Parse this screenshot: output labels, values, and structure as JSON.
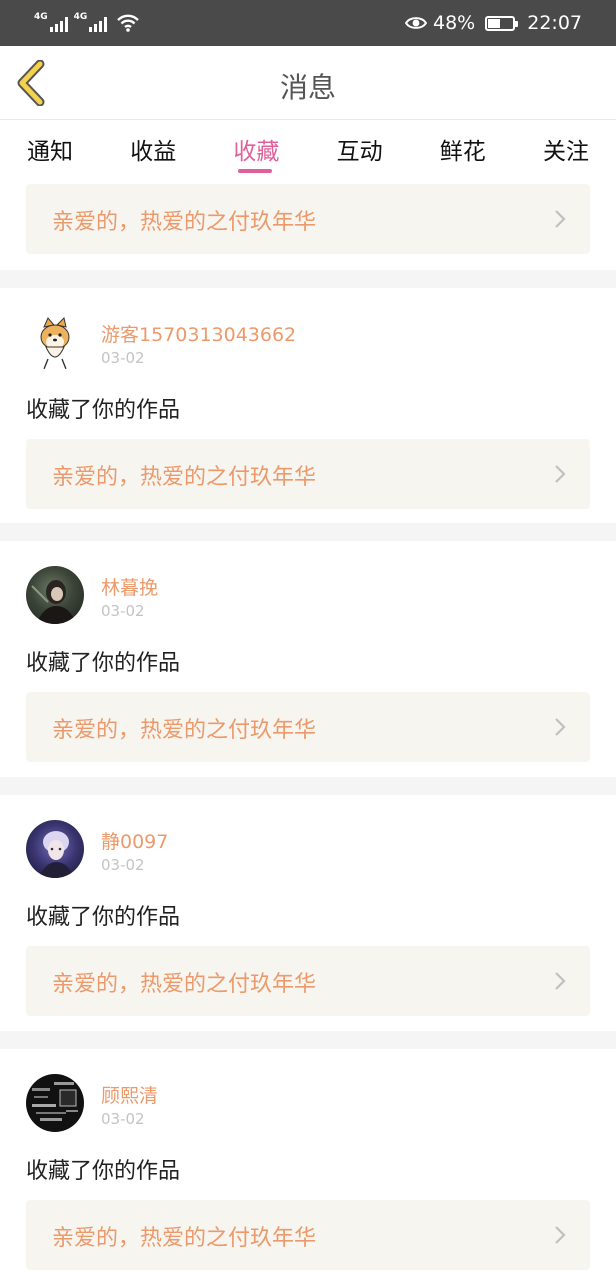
{
  "status_bar": {
    "network_1": "4G",
    "network_2": "4G",
    "battery_text": "48%",
    "battery_level": 0.48,
    "time": "22:07",
    "icons": [
      "signal-icon",
      "signal-icon",
      "wifi-icon",
      "eye-icon",
      "battery-icon"
    ]
  },
  "header": {
    "title": "消息",
    "back_icon": "chevron-left-icon",
    "accent_color": "#f5d24b"
  },
  "tabs": [
    {
      "label": "通知",
      "active": false
    },
    {
      "label": "收益",
      "active": false
    },
    {
      "label": "收藏",
      "active": true
    },
    {
      "label": "互动",
      "active": false
    },
    {
      "label": "鲜花",
      "active": false
    },
    {
      "label": "关注",
      "active": false
    }
  ],
  "colors": {
    "active_tab": "#e0609a",
    "username": "#ec9a6b",
    "card_bg": "#f6f5f0"
  },
  "top_card": {
    "work_title": "亲爱的，热爱的之付玖年华"
  },
  "items": [
    {
      "username": "游客1570313043662",
      "date": "03-02",
      "action": "收藏了你的作品",
      "work_title": "亲爱的，热爱的之付玖年华",
      "avatar": "shiba-dog-avatar"
    },
    {
      "username": "林暮挽",
      "date": "03-02",
      "action": "收藏了你的作品",
      "work_title": "亲爱的，热爱的之付玖年华",
      "avatar": "photo-avatar"
    },
    {
      "username": "静0097",
      "date": "03-02",
      "action": "收藏了你的作品",
      "work_title": "亲爱的，热爱的之付玖年华",
      "avatar": "photo-avatar"
    },
    {
      "username": "顾熙清",
      "date": "03-02",
      "action": "收藏了你的作品",
      "work_title": "亲爱的，热爱的之付玖年华",
      "avatar": "text-art-avatar"
    }
  ]
}
